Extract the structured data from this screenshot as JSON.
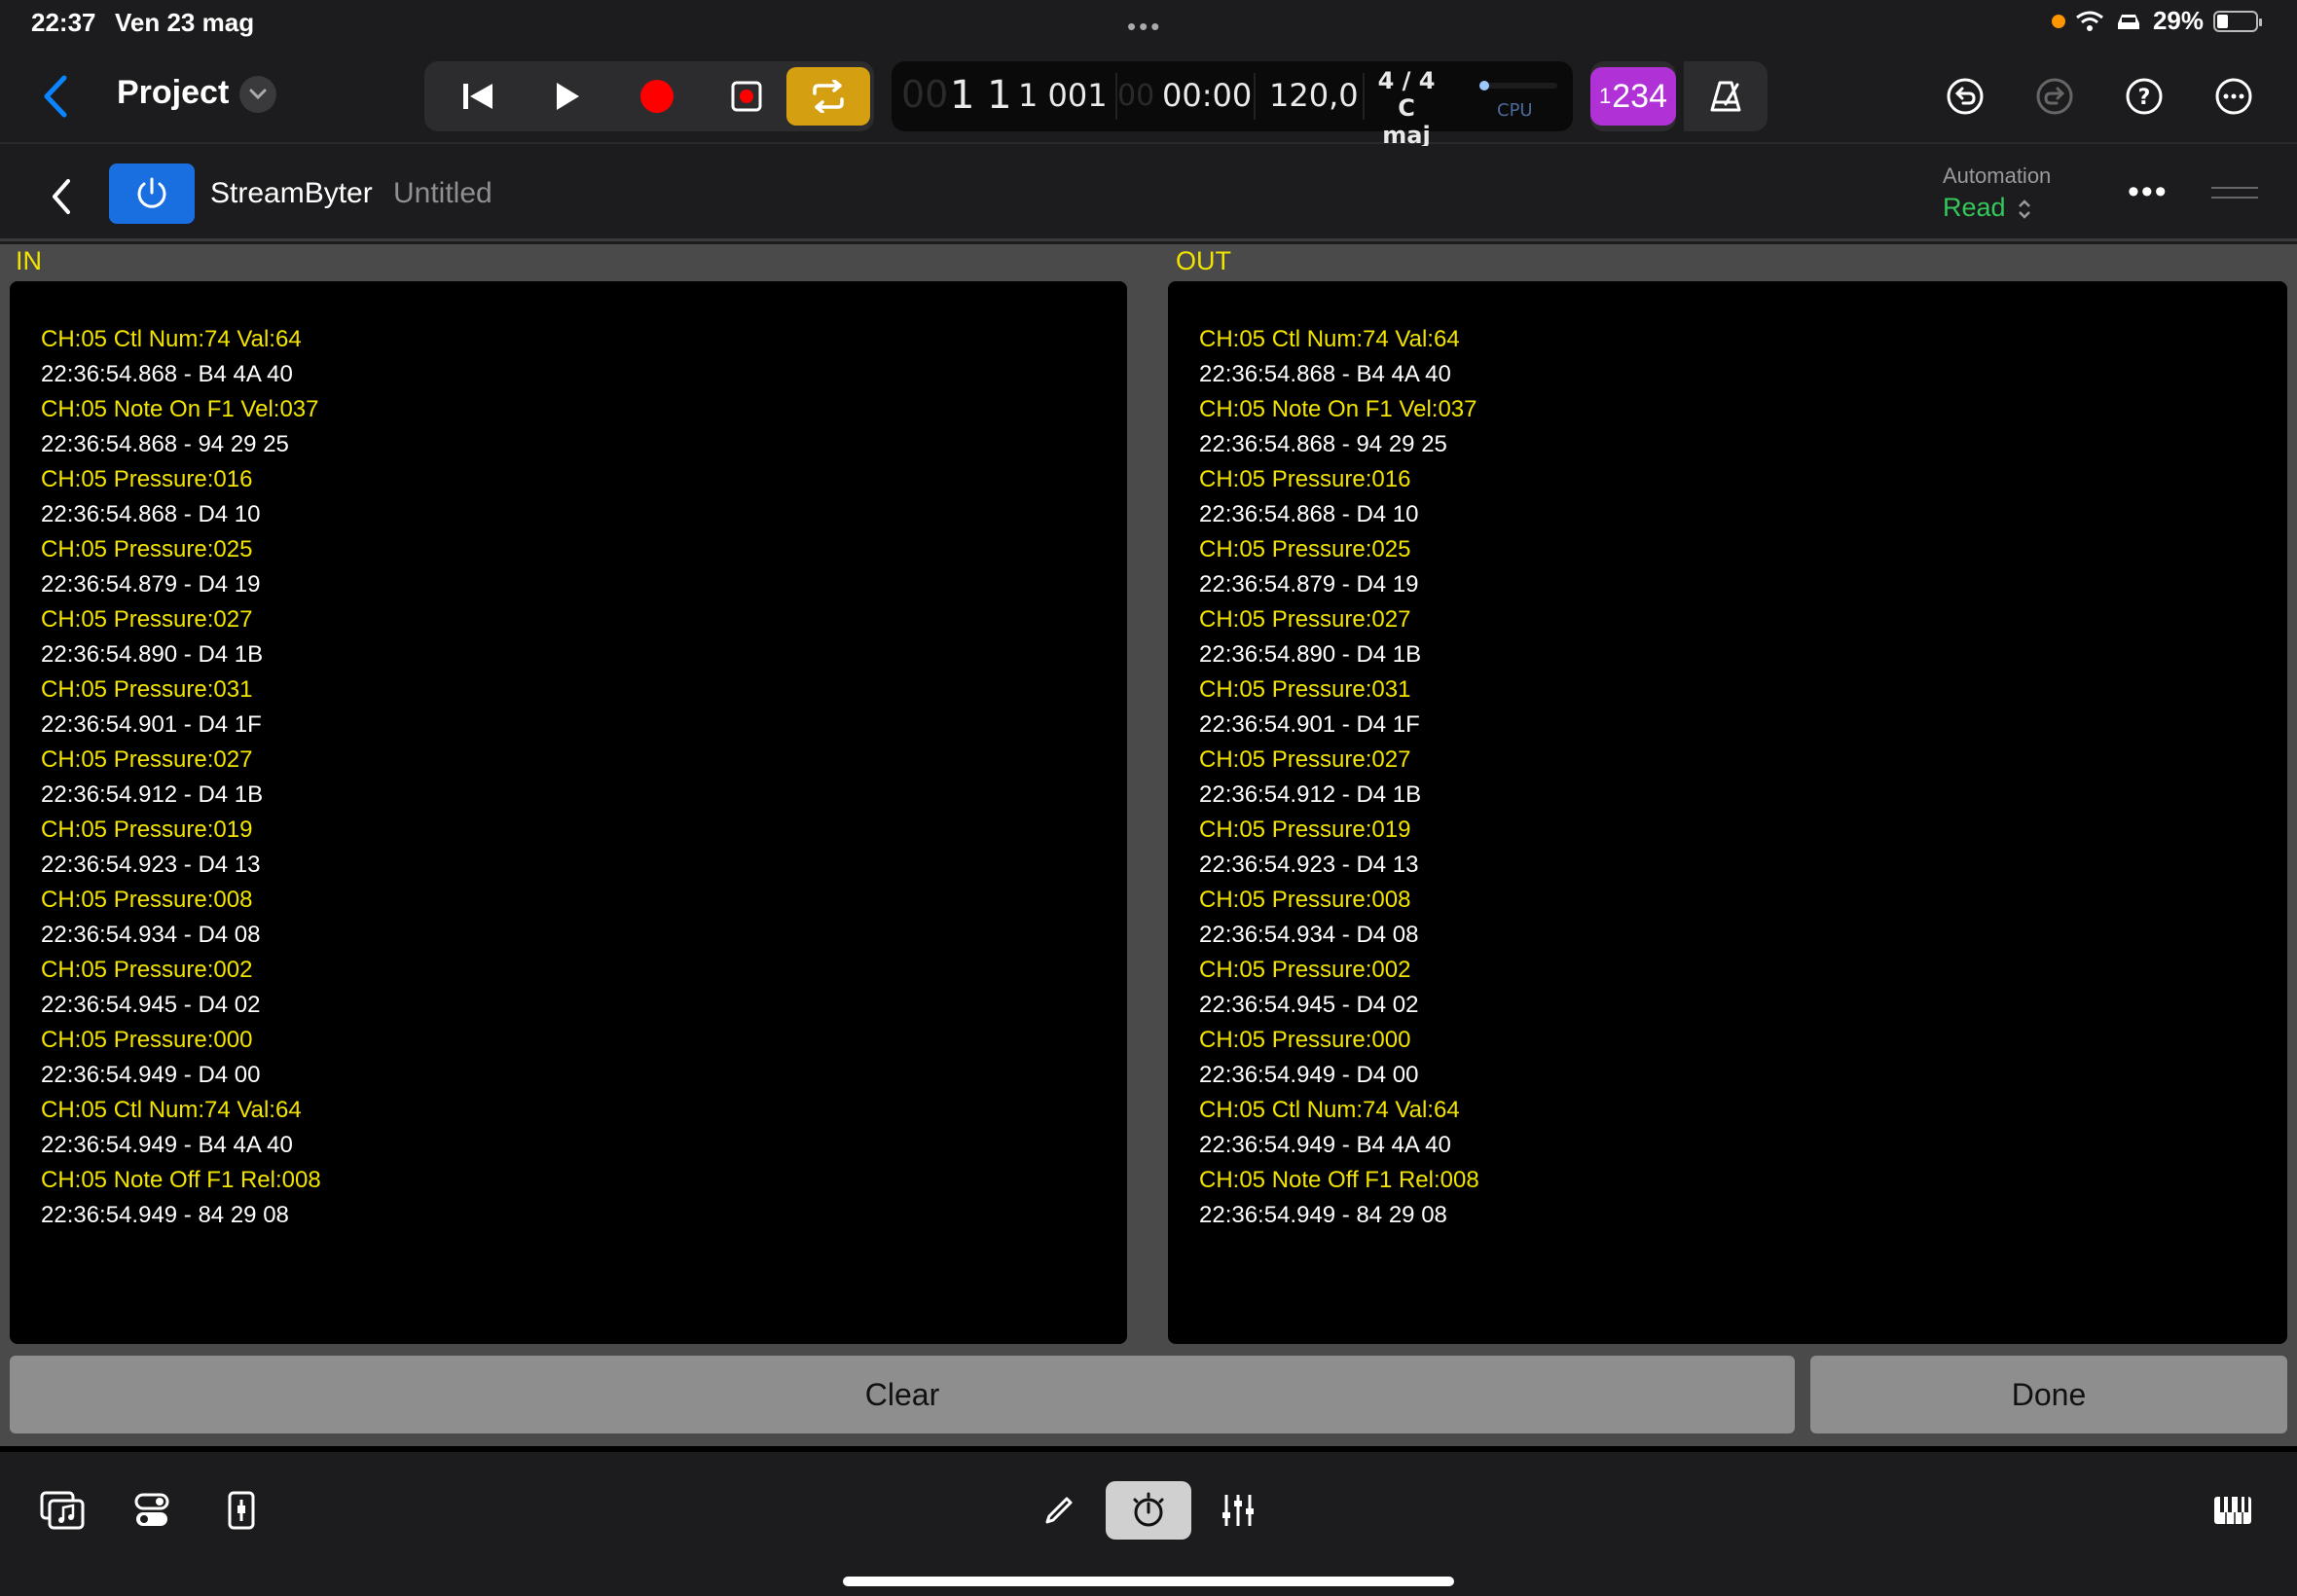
{
  "status_bar": {
    "time": "22:37",
    "date": "Ven 23 mag",
    "battery": "29%",
    "battery_level": 0.29
  },
  "toolbar": {
    "project_title": "Project",
    "lcd": {
      "bars_dim": "00",
      "bars": "1 1",
      "ticks": "1 001",
      "ticks_dim": "00",
      "time": "00:00",
      "tempo": "120,0",
      "time_signature": "4 / 4",
      "key": "C maj",
      "cpu_label": "CPU"
    },
    "count_in": {
      "small": "1",
      "large": "234"
    }
  },
  "plugin": {
    "name": "StreamByter",
    "preset": "Untitled",
    "automation_label": "Automation",
    "automation_value": "Read"
  },
  "monitor": {
    "in_label": "IN",
    "out_label": "OUT",
    "in_rows": [
      {
        "event": "CH:05 Ctl Num:74 Val:64",
        "raw": "22:36:54.868 - B4 4A 40"
      },
      {
        "event": "CH:05 Note On F1 Vel:037",
        "raw": "22:36:54.868 - 94 29 25"
      },
      {
        "event": "CH:05 Pressure:016",
        "raw": "22:36:54.868 - D4 10"
      },
      {
        "event": "CH:05 Pressure:025",
        "raw": "22:36:54.879 - D4 19"
      },
      {
        "event": "CH:05 Pressure:027",
        "raw": "22:36:54.890 - D4 1B"
      },
      {
        "event": "CH:05 Pressure:031",
        "raw": "22:36:54.901 - D4 1F"
      },
      {
        "event": "CH:05 Pressure:027",
        "raw": "22:36:54.912 - D4 1B"
      },
      {
        "event": "CH:05 Pressure:019",
        "raw": "22:36:54.923 - D4 13"
      },
      {
        "event": "CH:05 Pressure:008",
        "raw": "22:36:54.934 - D4 08"
      },
      {
        "event": "CH:05 Pressure:002",
        "raw": "22:36:54.945 - D4 02"
      },
      {
        "event": "CH:05 Pressure:000",
        "raw": "22:36:54.949 - D4 00"
      },
      {
        "event": "CH:05 Ctl Num:74 Val:64",
        "raw": "22:36:54.949 - B4 4A 40"
      },
      {
        "event": "CH:05 Note Off F1 Rel:008",
        "raw": "22:36:54.949 - 84 29 08"
      }
    ],
    "out_rows": [
      {
        "event": "CH:05 Ctl Num:74 Val:64",
        "raw": "22:36:54.868 - B4 4A 40"
      },
      {
        "event": "CH:05 Note On F1 Vel:037",
        "raw": "22:36:54.868 - 94 29 25"
      },
      {
        "event": "CH:05 Pressure:016",
        "raw": "22:36:54.868 - D4 10"
      },
      {
        "event": "CH:05 Pressure:025",
        "raw": "22:36:54.879 - D4 19"
      },
      {
        "event": "CH:05 Pressure:027",
        "raw": "22:36:54.890 - D4 1B"
      },
      {
        "event": "CH:05 Pressure:031",
        "raw": "22:36:54.901 - D4 1F"
      },
      {
        "event": "CH:05 Pressure:027",
        "raw": "22:36:54.912 - D4 1B"
      },
      {
        "event": "CH:05 Pressure:019",
        "raw": "22:36:54.923 - D4 13"
      },
      {
        "event": "CH:05 Pressure:008",
        "raw": "22:36:54.934 - D4 08"
      },
      {
        "event": "CH:05 Pressure:002",
        "raw": "22:36:54.945 - D4 02"
      },
      {
        "event": "CH:05 Pressure:000",
        "raw": "22:36:54.949 - D4 00"
      },
      {
        "event": "CH:05 Ctl Num:74 Val:64",
        "raw": "22:36:54.949 - B4 4A 40"
      },
      {
        "event": "CH:05 Note Off F1 Rel:008",
        "raw": "22:36:54.949 - 84 29 08"
      }
    ],
    "clear_label": "Clear",
    "done_label": "Done"
  },
  "colors": {
    "event_text": "#f2e400",
    "raw_text": "#ffffff",
    "accent_blue": "#1a6fe0",
    "cycle_yellow": "#d4a012",
    "record_red": "#ff0000",
    "count_in_purple": "#b032d6",
    "automation_green": "#34c759"
  },
  "icons": {
    "status": [
      "orange-dot",
      "wifi-icon",
      "car-icon",
      "battery-icon"
    ],
    "transport": [
      "go-to-start-icon",
      "play-icon",
      "record-icon",
      "capture-record-icon",
      "cycle-icon"
    ],
    "toolbar_right": [
      "undo-icon",
      "redo-icon",
      "help-icon",
      "more-icon"
    ],
    "bottom": [
      "browser-icon",
      "smart-controls-icon",
      "inspector-icon",
      "pencil-icon",
      "plugins-icon",
      "mixer-icon",
      "keyboard-icon"
    ]
  }
}
